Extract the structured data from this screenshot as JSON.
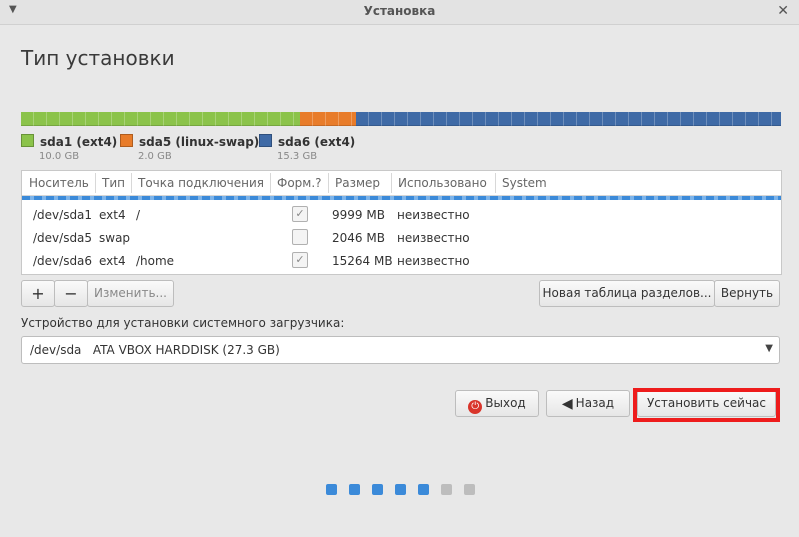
{
  "window": {
    "title": "Установка"
  },
  "page_title": "Тип установки",
  "partitions_bar": [
    {
      "name": "sda1 (ext4)",
      "size": "10.0 GB",
      "color": "#8bc34a"
    },
    {
      "name": "sda5 (linux-swap)",
      "size": "2.0 GB",
      "color": "#e87c2a"
    },
    {
      "name": "sda6 (ext4)",
      "size": "15.3 GB",
      "color": "#3f6aa6"
    }
  ],
  "table": {
    "headers": [
      "Носитель",
      "Тип",
      "Точка подключения",
      "Форм.?",
      "Размер",
      "Использовано",
      "System"
    ],
    "rows": [
      {
        "device": "/dev/sda1",
        "type": "ext4",
        "mount": "/",
        "format": true,
        "size": "9999 MB",
        "used": "неизвестно"
      },
      {
        "device": "/dev/sda5",
        "type": "swap",
        "mount": "",
        "format": false,
        "size": "2046 MB",
        "used": "неизвестно"
      },
      {
        "device": "/dev/sda6",
        "type": "ext4",
        "mount": "/home",
        "format": true,
        "size": "15264 MB",
        "used": "неизвестно"
      }
    ]
  },
  "buttons": {
    "add": "+",
    "remove": "−",
    "change": "Изменить...",
    "new_table": "Новая таблица разделов...",
    "revert": "Вернуть",
    "quit": "Выход",
    "back": "Назад",
    "install_now": "Установить сейчас"
  },
  "bootloader": {
    "label": "Устройство для установки системного загрузчика:",
    "device": "/dev/sda",
    "description": "ATA VBOX HARDDISK (27.3 GB)"
  },
  "progress": {
    "total": 7,
    "completed": 5,
    "active_color": "#3b8ad9",
    "inactive_color": "#bdbdbd"
  }
}
